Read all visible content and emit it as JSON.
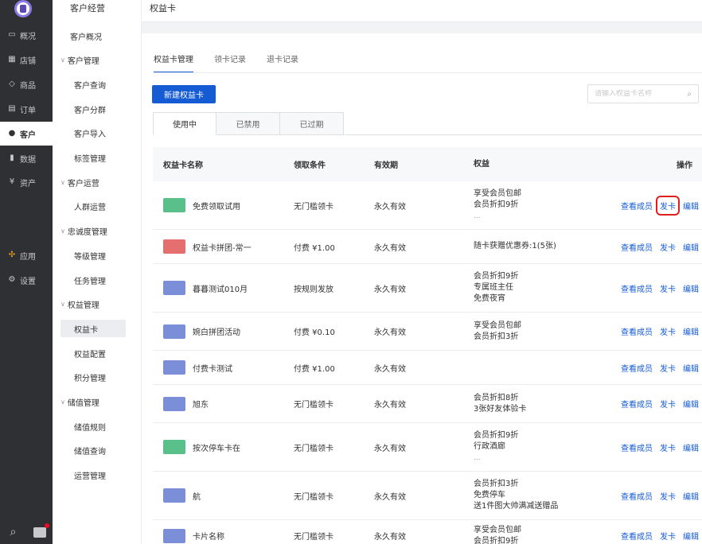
{
  "nav": {
    "items": [
      {
        "label": "概况",
        "icon": "monitor-icon",
        "glyph": "▭"
      },
      {
        "label": "店铺",
        "icon": "shop-icon",
        "glyph": "▦"
      },
      {
        "label": "商品",
        "icon": "tag-icon",
        "glyph": "◇"
      },
      {
        "label": "订单",
        "icon": "order-icon",
        "glyph": "▤"
      },
      {
        "label": "客户",
        "icon": "user-icon",
        "glyph": "●",
        "active": true
      },
      {
        "label": "数据",
        "icon": "bar-chart-icon",
        "glyph": "▮"
      },
      {
        "label": "资产",
        "icon": "asset-icon",
        "glyph": "¥"
      },
      {
        "label": "应用",
        "icon": "apps-icon",
        "glyph": "✣"
      },
      {
        "label": "设置",
        "icon": "gear-icon",
        "glyph": "⚙"
      }
    ]
  },
  "sub": {
    "title": "客户经营",
    "items": [
      {
        "label": "客户概况",
        "kind": "top"
      },
      {
        "label": "客户管理",
        "kind": "group"
      },
      {
        "label": "客户查询",
        "kind": "child"
      },
      {
        "label": "客户分群",
        "kind": "child"
      },
      {
        "label": "客户导入",
        "kind": "child"
      },
      {
        "label": "标签管理",
        "kind": "child"
      },
      {
        "label": "客户运营",
        "kind": "group"
      },
      {
        "label": "人群运营",
        "kind": "child"
      },
      {
        "label": "忠诚度管理",
        "kind": "group"
      },
      {
        "label": "等级管理",
        "kind": "child"
      },
      {
        "label": "任务管理",
        "kind": "child"
      },
      {
        "label": "权益管理",
        "kind": "group"
      },
      {
        "label": "权益卡",
        "kind": "child",
        "selected": true
      },
      {
        "label": "权益配置",
        "kind": "child"
      },
      {
        "label": "积分管理",
        "kind": "child"
      },
      {
        "label": "储值管理",
        "kind": "group"
      },
      {
        "label": "储值规则",
        "kind": "child"
      },
      {
        "label": "储值查询",
        "kind": "child"
      },
      {
        "label": "运营管理",
        "kind": "child"
      }
    ]
  },
  "header": {
    "breadcrumb": "权益卡"
  },
  "tabs": [
    "权益卡管理",
    "领卡记录",
    "退卡记录"
  ],
  "new_button": "新建权益卡",
  "search": {
    "placeholder": "请输入权益卡名称"
  },
  "status_tabs": [
    "使用中",
    "已禁用",
    "已过期"
  ],
  "table": {
    "headers": {
      "name": "权益卡名称",
      "cond": "领取条件",
      "valid": "有效期",
      "rights": "权益",
      "ops": "操作"
    },
    "op_labels": [
      "查看成员",
      "发卡",
      "编辑"
    ],
    "rows": [
      {
        "name": "免费领取试用",
        "color": "#5ac08a",
        "cond": "无门槛领卡",
        "valid": "永久有效",
        "rights": [
          "享受会员包邮",
          "会员折扣9折",
          "..."
        ],
        "highlight": true
      },
      {
        "name": "权益卡拼团-常一",
        "color": "#e56e6e",
        "cond": "付费 ¥1.00",
        "valid": "永久有效",
        "rights": [
          "随卡获赠优惠券:1(5张)"
        ]
      },
      {
        "name": "暮暮测试010月",
        "color": "#7b8fd8",
        "cond": "按规则发放",
        "valid": "永久有效",
        "rights": [
          "会员折扣9折",
          "专属班主任",
          "免费夜宵"
        ]
      },
      {
        "name": "婉白拼团活动",
        "color": "#7b8fd8",
        "cond": "付费 ¥0.10",
        "valid": "永久有效",
        "rights": [
          "享受会员包邮",
          "会员折扣3折"
        ]
      },
      {
        "name": "付费卡测试",
        "color": "#7b8fd8",
        "cond": "付费 ¥1.00",
        "valid": "永久有效",
        "rights": []
      },
      {
        "name": "旭东",
        "color": "#7b8fd8",
        "cond": "无门槛领卡",
        "valid": "永久有效",
        "rights": [
          "会员折扣8折",
          "3张好友体验卡"
        ]
      },
      {
        "name": "按次停车卡在",
        "color": "#5ac08a",
        "cond": "无门槛领卡",
        "valid": "永久有效",
        "rights": [
          "会员折扣9折",
          "行政酒廊",
          "..."
        ]
      },
      {
        "name": "航",
        "color": "#7b8fd8",
        "cond": "无门槛领卡",
        "valid": "永久有效",
        "rights": [
          "会员折扣3折",
          "免费停车",
          "送1件图大帅满减送赠品"
        ]
      },
      {
        "name": "卡片名称",
        "color": "#7b8fd8",
        "cond": "无门槛领卡",
        "valid": "永久有效",
        "rights": [
          "享受会员包邮",
          "会员折扣9折"
        ]
      }
    ]
  }
}
